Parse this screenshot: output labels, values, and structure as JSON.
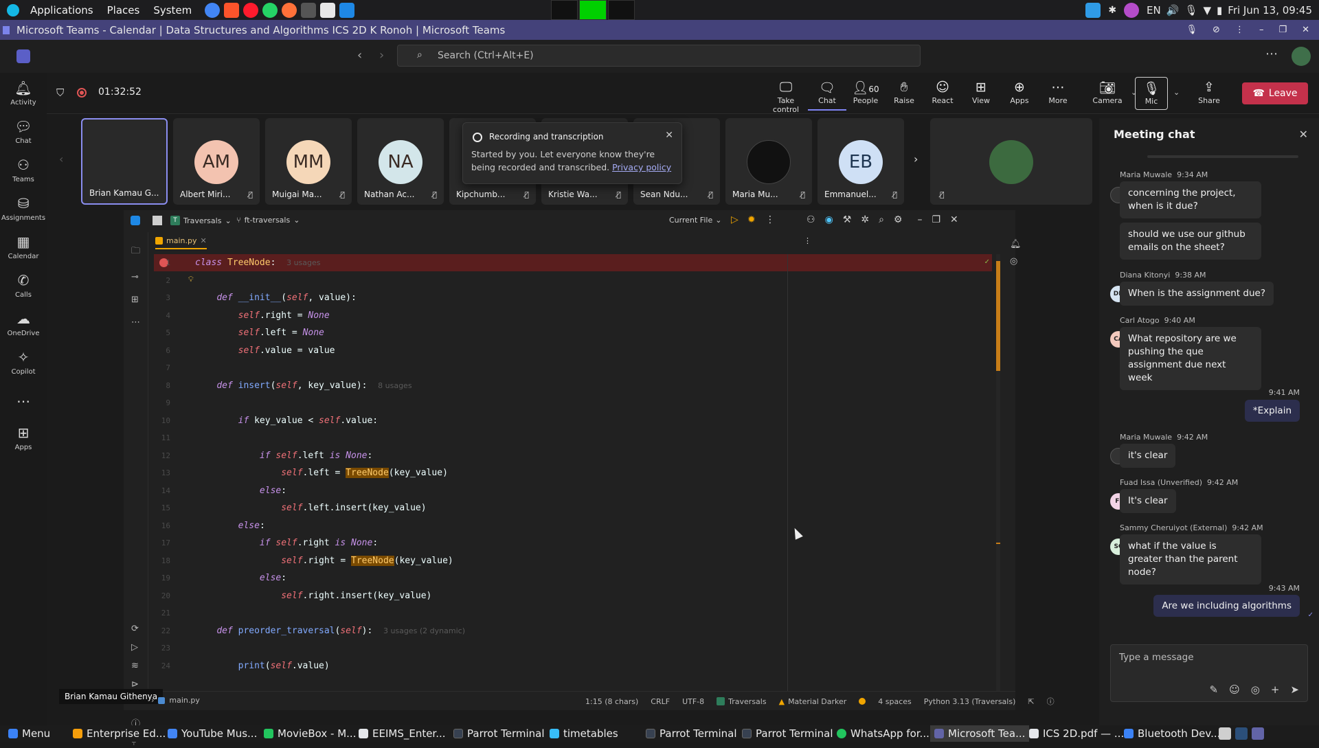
{
  "sysbar": {
    "menus": [
      "Applications",
      "Places",
      "System"
    ],
    "lang": "EN",
    "datetime": "Fri Jun 13, 09:45"
  },
  "titlebar": {
    "title": "Microsoft Teams - Calendar | Data Structures and Algorithms ICS 2D K Ronoh | Microsoft Teams"
  },
  "header": {
    "search_placeholder": "Search (Ctrl+Alt+E)"
  },
  "rail": [
    {
      "label": "Activity",
      "icon": "bell-icon"
    },
    {
      "label": "Chat",
      "icon": "chat-icon"
    },
    {
      "label": "Teams",
      "icon": "teams-icon"
    },
    {
      "label": "Assignments",
      "icon": "assignments-icon"
    },
    {
      "label": "Calendar",
      "icon": "calendar-icon"
    },
    {
      "label": "Calls",
      "icon": "phone-icon"
    },
    {
      "label": "OneDrive",
      "icon": "cloud-icon"
    },
    {
      "label": "Copilot",
      "icon": "copilot-icon"
    },
    {
      "label": "Apps",
      "icon": "apps-icon"
    }
  ],
  "meeting": {
    "timer": "01:32:52",
    "toolbar": {
      "take_control": "Take control",
      "chat": "Chat",
      "people": "People",
      "people_count": "60",
      "raise": "Raise",
      "react": "React",
      "view": "View",
      "apps": "Apps",
      "more": "More",
      "camera": "Camera",
      "mic": "Mic",
      "share": "Share",
      "leave": "Leave"
    },
    "participants": [
      {
        "name": "Brian Kamau G...",
        "initials": "",
        "color": "#292929"
      },
      {
        "name": "Albert Miri...",
        "initials": "AM",
        "color": "#f3c3b0"
      },
      {
        "name": "Muigai Ma...",
        "initials": "MM",
        "color": "#f5d7b8"
      },
      {
        "name": "Nathan Ac...",
        "initials": "NA",
        "color": "#d3e6ea"
      },
      {
        "name": "Kipchumb...",
        "initials": "",
        "color": "#292929"
      },
      {
        "name": "Kristie Wa...",
        "initials": "",
        "color": "#292929"
      },
      {
        "name": "Sean Ndu...",
        "initials": "",
        "color": "#292929"
      },
      {
        "name": "Maria Mu...",
        "initials": "",
        "color": "#111111"
      },
      {
        "name": "Emmanuel...",
        "initials": "EB",
        "color": "#cfe0f5"
      }
    ],
    "recording_popup": {
      "title": "Recording and transcription",
      "body": "Started by you. Let everyone know they're being recorded and transcribed.",
      "link": "Privacy policy"
    }
  },
  "ide": {
    "project": "Traversals",
    "branch": "ft-traversals",
    "run_config": "Current File",
    "tab": "main.py",
    "code": [
      {
        "n": "1",
        "html": "<span class='kw'>class</span> <span class='cls'>TreeNode</span>:  <span class='hint'>3 usages</span>"
      },
      {
        "n": "2",
        "html": ""
      },
      {
        "n": "3",
        "html": "    <span class='kw'>def</span> <span class='fn'>__init__</span>(<span class='self'>self</span>, value):"
      },
      {
        "n": "4",
        "html": "        <span class='self'>self</span>.right = <span class='none'>None</span>"
      },
      {
        "n": "5",
        "html": "        <span class='self'>self</span>.left = <span class='none'>None</span>"
      },
      {
        "n": "6",
        "html": "        <span class='self'>self</span>.value = value"
      },
      {
        "n": "7",
        "html": ""
      },
      {
        "n": "8",
        "html": "    <span class='kw'>def</span> <span class='fn'>insert</span>(<span class='self'>self</span>, key_value):  <span class='hint'>8 usages</span>"
      },
      {
        "n": "9",
        "html": ""
      },
      {
        "n": "10",
        "html": "        <span class='kw'>if</span> key_value &lt; <span class='self'>self</span>.value:"
      },
      {
        "n": "11",
        "html": ""
      },
      {
        "n": "12",
        "html": "            <span class='kw'>if</span> <span class='self'>self</span>.left <span class='kw'>is</span> <span class='none'>None</span>:"
      },
      {
        "n": "13",
        "html": "                <span class='self'>self</span>.left = <span class='hl'>TreeNode</span>(key_value)"
      },
      {
        "n": "14",
        "html": "            <span class='kw'>else</span>:"
      },
      {
        "n": "15",
        "html": "                <span class='self'>self</span>.left.insert(key_value)"
      },
      {
        "n": "16",
        "html": "        <span class='kw'>else</span>:"
      },
      {
        "n": "17",
        "html": "            <span class='kw'>if</span> <span class='self'>self</span>.right <span class='kw'>is</span> <span class='none'>None</span>:"
      },
      {
        "n": "18",
        "html": "                <span class='self'>self</span>.right = <span class='hl'>TreeNode</span>(key_value)"
      },
      {
        "n": "19",
        "html": "            <span class='kw'>else</span>:"
      },
      {
        "n": "20",
        "html": "                <span class='self'>self</span>.right.insert(key_value)"
      },
      {
        "n": "21",
        "html": ""
      },
      {
        "n": "22",
        "html": "    <span class='kw'>def</span> <span class='fn'>preorder_traversal</span>(<span class='self'>self</span>):  <span class='hint'>3 usages (2 dynamic)</span>"
      },
      {
        "n": "23",
        "html": ""
      },
      {
        "n": "24",
        "html": "        <span class='fn'>print</span>(<span class='self'>self</span>.value)"
      }
    ],
    "status": {
      "presenter": "Brian Kamau Githenya",
      "path": "main.py",
      "pos": "1:15 (8 chars)",
      "eol": "CRLF",
      "enc": "UTF-8",
      "project": "Traversals",
      "theme": "Material Darker",
      "indent": "4 spaces",
      "interpreter": "Python 3.13 (Traversals)"
    }
  },
  "chat": {
    "title": "Meeting chat",
    "input_placeholder": "Type a message",
    "messages": [
      {
        "sender": "Maria Muwale",
        "time": "9:34 AM",
        "texts": [
          "concerning the project, when is it due?",
          "should we use our github emails on the sheet?"
        ],
        "initials": "",
        "avcolor": "#333"
      },
      {
        "sender": "Diana Kitonyi",
        "time": "9:38 AM",
        "texts": [
          "When is the assignment due?"
        ],
        "initials": "DK",
        "avcolor": "#d6e4f2"
      },
      {
        "sender": "Carl Atogo",
        "time": "9:40 AM",
        "texts": [
          "What repository are we pushing the que assignment due next week"
        ],
        "initials": "CA",
        "avcolor": "#f3c9bd"
      }
    ],
    "mine1": {
      "time": "9:41 AM",
      "text": "*Explain"
    },
    "messages2": [
      {
        "sender": "Maria Muwale",
        "time": "9:42 AM",
        "text": "it's clear",
        "initials": "",
        "avcolor": "#333"
      },
      {
        "sender": "Fuad Issa (Unverified)",
        "time": "9:42 AM",
        "text": "It's clear",
        "initials": "FI",
        "avcolor": "#f2d3e6"
      },
      {
        "sender": "Sammy Cheruiyot (External)",
        "time": "9:42 AM",
        "text": "what if the value is greater than the parent node?",
        "initials": "SC",
        "avcolor": "#d8efdc"
      }
    ],
    "mine2": {
      "time": "9:43 AM",
      "text": "Are we including algorithms"
    }
  },
  "taskbar": [
    {
      "label": "Menu",
      "color": "#3b82f6"
    },
    {
      "label": "Enterprise Ed...",
      "color": "#f59e0b"
    },
    {
      "label": "YouTube Mus...",
      "color": "#4285f4"
    },
    {
      "label": "MovieBox - M...",
      "color": "#22c55e"
    },
    {
      "label": "EEIMS_Enter...",
      "color": "#e5e7eb"
    },
    {
      "label": "Parrot Terminal",
      "color": "#374151"
    },
    {
      "label": "timetables",
      "color": "#38bdf8"
    },
    {
      "label": "Parrot Terminal",
      "color": "#374151"
    },
    {
      "label": "Parrot Terminal",
      "color": "#374151"
    },
    {
      "label": "WhatsApp for...",
      "color": "#22c55e"
    },
    {
      "label": "Microsoft Tea...",
      "color": "#6264a7"
    },
    {
      "label": "ICS 2D.pdf — ...",
      "color": "#e5e7eb"
    },
    {
      "label": "Bluetooth Dev...",
      "color": "#3b82f6"
    }
  ]
}
